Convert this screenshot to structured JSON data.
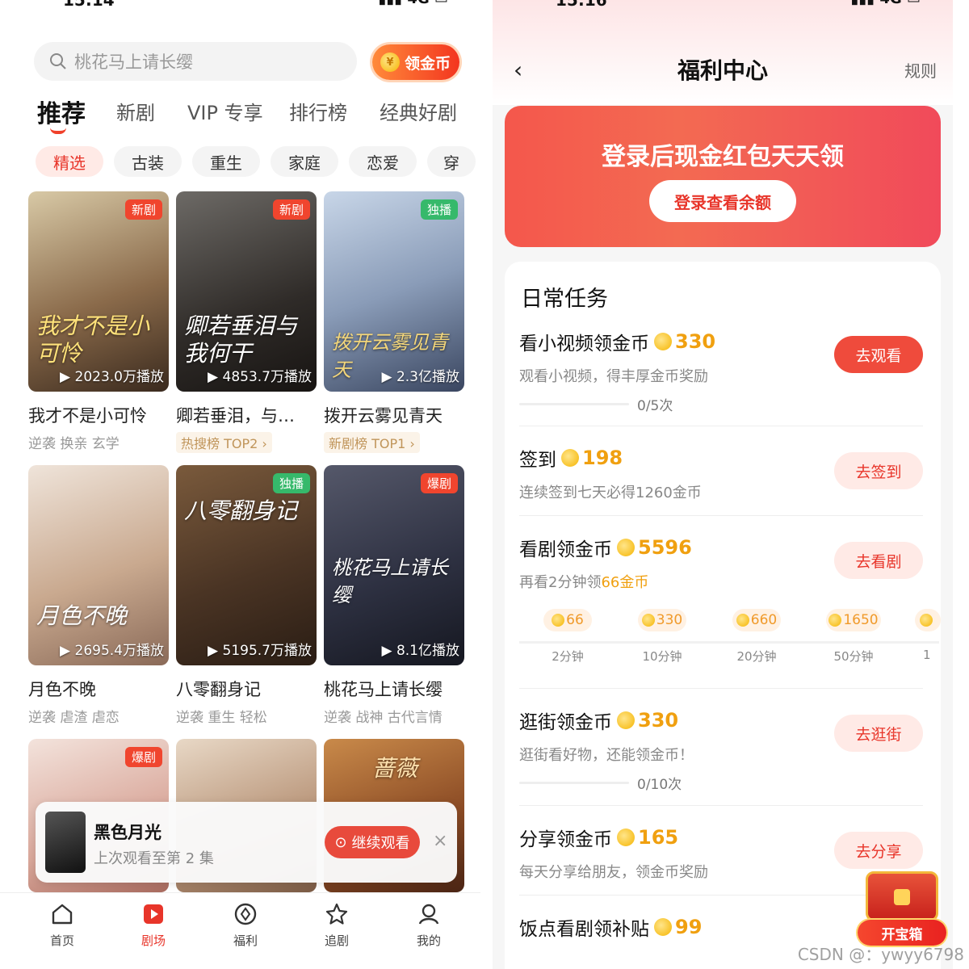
{
  "left": {
    "search_placeholder": "桃花马上请长缨",
    "coin_button": "领金币",
    "tabs": [
      "推荐",
      "新剧",
      "VIP 专享",
      "排行榜",
      "经典好剧"
    ],
    "chips": [
      "精选",
      "古装",
      "重生",
      "家庭",
      "恋爱",
      "穿"
    ],
    "cards": [
      {
        "title": "我才不是小可怜",
        "plays": "2023.0万播放",
        "badge": "新剧",
        "tags": "逆袭 换亲 玄学",
        "poster_text": "我才不是小可怜"
      },
      {
        "title": "卿若垂泪，与…",
        "plays": "4853.7万播放",
        "badge": "新剧",
        "rank": "热搜榜 TOP2",
        "poster_text": "卿若垂泪与我何干"
      },
      {
        "title": "拨开云雾见青天",
        "plays": "2.3亿播放",
        "badge": "独播",
        "rank": "新剧榜 TOP1",
        "poster_text": "拨开云雾见青天"
      },
      {
        "title": "月色不晚",
        "plays": "2695.4万播放",
        "badge": "",
        "tags": "逆袭 虐渣 虐恋",
        "poster_text": "月色不晚"
      },
      {
        "title": "八零翻身记",
        "plays": "5195.7万播放",
        "badge": "独播",
        "tags": "逆袭 重生 轻松",
        "poster_text": "八零翻身记"
      },
      {
        "title": "桃花马上请长缨",
        "plays": "8.1亿播放",
        "badge": "爆剧",
        "tags": "逆袭 战神 古代言情",
        "poster_text": "桃花马上请长缨"
      }
    ],
    "row3_badge": "爆剧",
    "row3_poster_text": "蔷薇",
    "continue": {
      "title": "黑色月光",
      "subtitle": "上次观看至第 2 集",
      "button": "继续观看",
      "close": "×"
    },
    "nav": [
      "首页",
      "剧场",
      "福利",
      "追剧",
      "我的"
    ]
  },
  "right": {
    "title": "福利中心",
    "rules": "规则",
    "banner_text": "登录后现金红包天天领",
    "banner_button": "登录查看余额",
    "section_title": "日常任务",
    "tasks": [
      {
        "name": "看小视频领金币",
        "coins": "330",
        "desc": "观看小视频，得丰厚金币奖励",
        "progress": "0/5次",
        "button": "去观看"
      },
      {
        "name": "签到",
        "coins": "198",
        "desc": "连续签到七天必得1260金币",
        "button": "去签到"
      },
      {
        "name": "看剧领金币",
        "coins": "5596",
        "desc_pre": "再看2分钟领",
        "desc_hl": "66金币",
        "button": "去看剧"
      },
      {
        "name": "逛街领金币",
        "coins": "330",
        "desc": "逛街看好物，还能领金币！",
        "progress": "0/10次",
        "button": "去逛街"
      },
      {
        "name": "分享领金币",
        "coins": "165",
        "desc": "每天分享给朋友，领金币奖励",
        "button": "去分享"
      },
      {
        "name": "饭点看剧领补贴",
        "coins": "99"
      }
    ],
    "milestones": [
      {
        "coins": "66",
        "time": "2分钟"
      },
      {
        "coins": "330",
        "time": "10分钟"
      },
      {
        "coins": "660",
        "time": "20分钟"
      },
      {
        "coins": "1650",
        "time": "50分钟"
      }
    ],
    "milestone_partial": "1",
    "chest_label": "开宝箱",
    "watermark": "CSDN @：ywyy6798"
  }
}
